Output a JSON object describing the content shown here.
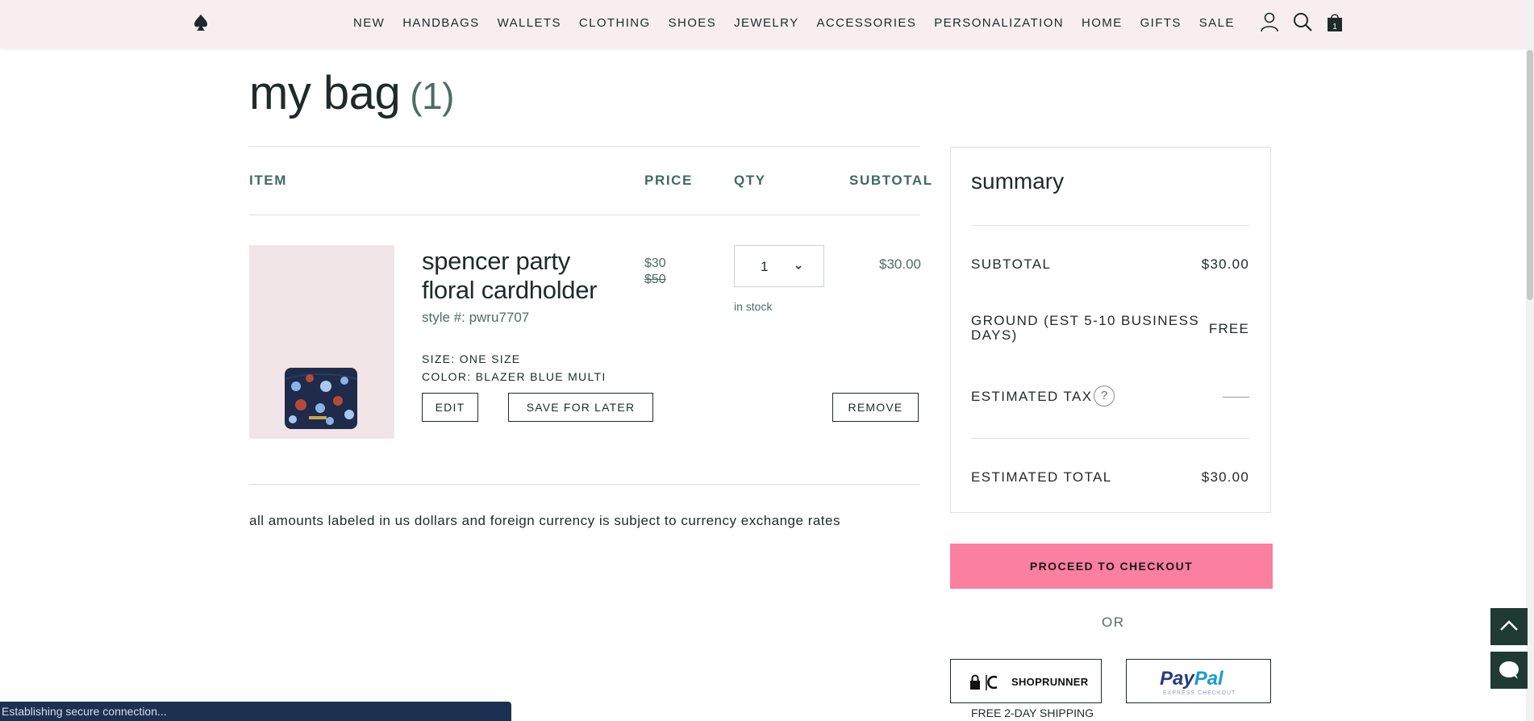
{
  "nav": {
    "logo": "spade-logo",
    "items": [
      "NEW",
      "HANDBAGS",
      "WALLETS",
      "CLOTHING",
      "SHOES",
      "JEWELRY",
      "ACCESSORIES",
      "PERSONALIZATION",
      "HOME",
      "GIFTS",
      "SALE"
    ],
    "icons": [
      "account-icon",
      "search-icon",
      "shopping-bag-icon"
    ],
    "bag_count": "1"
  },
  "page": {
    "title": "my bag",
    "count": "(1)"
  },
  "table": {
    "headers": {
      "item": "ITEM",
      "price": "PRICE",
      "qty": "QTY",
      "subtotal": "SUBTOTAL"
    }
  },
  "item": {
    "name": "spencer party floral cardholder",
    "style": "style #: pwru7707",
    "size": "SIZE: ONE SIZE",
    "color": "COLOR: BLAZER BLUE MULTI",
    "price_now": "$30",
    "price_was": "$50",
    "qty": "1",
    "stock": "in stock",
    "subtotal": "$30.00",
    "edit_label": "EDIT",
    "save_label": "SAVE FOR LATER",
    "remove_label": "REMOVE",
    "image_colors": {
      "background": "#f1e4e6",
      "wallet": "#1f2b4a"
    }
  },
  "disclaimer": "all amounts labeled in us dollars and foreign currency is subject to currency exchange rates",
  "summary": {
    "title": "summary",
    "subtotal_label": "SUBTOTAL",
    "subtotal_value": "$30.00",
    "shipping_label_line1": "GROUND (EST 5-10 BUSINESS",
    "shipping_label_line2": "DAYS)",
    "shipping_value": "FREE",
    "tax_label": "ESTIMATED TAX",
    "tax_help": "?",
    "total_label": "ESTIMATED TOTAL",
    "total_value": "$30.00",
    "checkout_label": "PROCEED TO CHECKOUT",
    "or_label": "OR",
    "shoprunner_label": "SHOPRUNNER",
    "paypal_pay": "Pay",
    "paypal_pal": "Pal",
    "paypal_sub": "EXPRESS CHECKOUT",
    "shipping_note": "FREE 2-DAY SHIPPING"
  },
  "colors": {
    "accent_pink": "#fb7fa0",
    "header_bg": "#f8eef0",
    "teal_text": "#3f6a60",
    "dark_green": "#1e3a33"
  },
  "floating": {
    "scroll_top": "chevron-up-icon",
    "chat": "chat-icon"
  },
  "status_bar": "Establishing secure connection..."
}
